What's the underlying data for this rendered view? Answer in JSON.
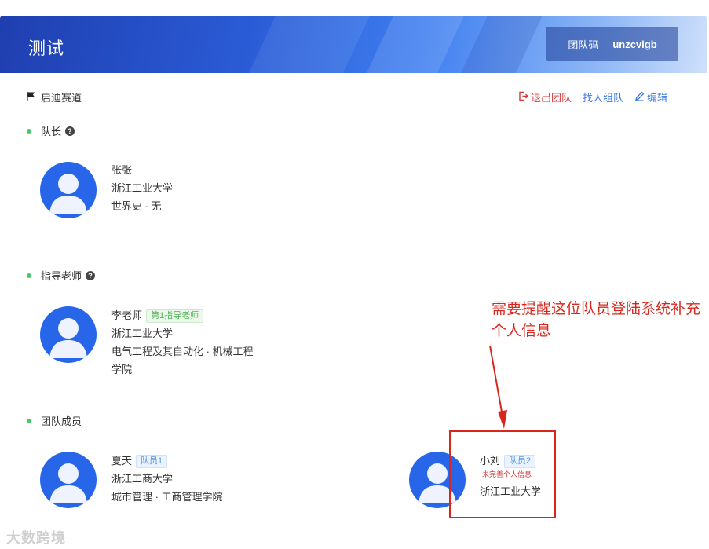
{
  "header": {
    "title": "测试",
    "team_code_label": "团队码",
    "team_code_value": "unzcvigb"
  },
  "toolbar": {
    "track_label": "启迪赛道",
    "quit_label": "退出团队",
    "find_label": "找人组队",
    "edit_label": "编辑"
  },
  "captain": {
    "heading": "队长",
    "name": "张张",
    "school": "浙江工业大学",
    "detail": "世界史 · 无"
  },
  "advisor": {
    "heading": "指导老师",
    "name": "李老师",
    "tag": "第1指导老师",
    "school": "浙江工业大学",
    "detail_line1": "电气工程及其自动化 · 机械工程",
    "detail_line2": "学院"
  },
  "members": {
    "heading": "团队成员",
    "list": [
      {
        "name": "夏天",
        "tag": "队员1",
        "school": "浙江工商大学",
        "detail": "城市管理 · 工商管理学院"
      },
      {
        "name": "小刘",
        "tag": "队员2",
        "warning": "未完善个人信息",
        "school": "浙江工业大学"
      }
    ]
  },
  "annotation": {
    "text": "需要提醒这位队员登陆系统补充个人信息",
    "color": "#d9261c"
  },
  "watermark": "大数跨境",
  "colors": {
    "accent": "#2766e8",
    "quit": "#d23a3a",
    "link": "#3b7be0",
    "dot": "#47c96a"
  }
}
